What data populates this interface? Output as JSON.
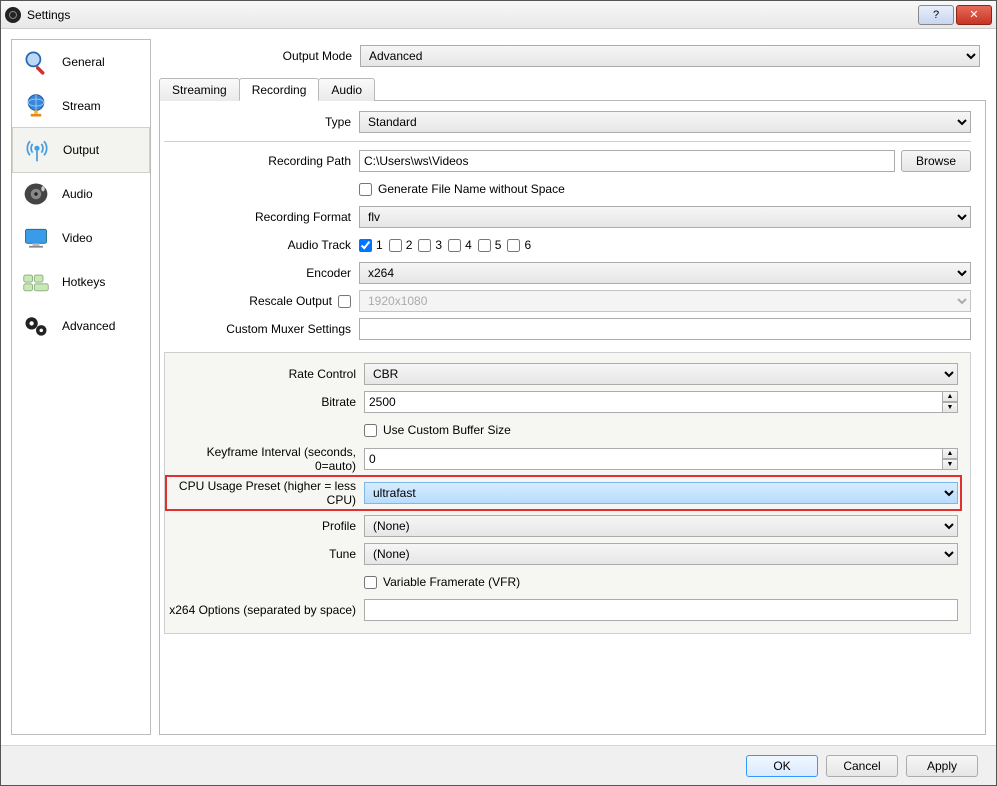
{
  "window": {
    "title": "Settings"
  },
  "winbuttons": {
    "help": "?",
    "close": "✕"
  },
  "sidebar": {
    "items": [
      {
        "label": "General"
      },
      {
        "label": "Stream"
      },
      {
        "label": "Output"
      },
      {
        "label": "Audio"
      },
      {
        "label": "Video"
      },
      {
        "label": "Hotkeys"
      },
      {
        "label": "Advanced"
      }
    ]
  },
  "output_mode": {
    "label": "Output Mode",
    "value": "Advanced"
  },
  "tabs": {
    "streaming": "Streaming",
    "recording": "Recording",
    "audio": "Audio"
  },
  "recording": {
    "type_label": "Type",
    "type_value": "Standard",
    "path_label": "Recording Path",
    "path_value": "C:\\Users\\ws\\Videos",
    "browse": "Browse",
    "gen_space": "Generate File Name without Space",
    "format_label": "Recording Format",
    "format_value": "flv",
    "audio_track_label": "Audio Track",
    "tracks": [
      "1",
      "2",
      "3",
      "4",
      "5",
      "6"
    ],
    "encoder_label": "Encoder",
    "encoder_value": "x264",
    "rescale_label": "Rescale Output",
    "rescale_value": "1920x1080",
    "muxer_label": "Custom Muxer Settings",
    "muxer_value": ""
  },
  "encoder": {
    "rate_control_label": "Rate Control",
    "rate_control_value": "CBR",
    "bitrate_label": "Bitrate",
    "bitrate_value": "2500",
    "custom_buffer": "Use Custom Buffer Size",
    "keyframe_label": "Keyframe Interval (seconds, 0=auto)",
    "keyframe_value": "0",
    "cpu_preset_label": "CPU Usage Preset (higher = less CPU)",
    "cpu_preset_value": "ultrafast",
    "profile_label": "Profile",
    "profile_value": "(None)",
    "tune_label": "Tune",
    "tune_value": "(None)",
    "vfr": "Variable Framerate (VFR)",
    "x264opts_label": "x264 Options (separated by space)",
    "x264opts_value": ""
  },
  "footer": {
    "ok": "OK",
    "cancel": "Cancel",
    "apply": "Apply"
  }
}
